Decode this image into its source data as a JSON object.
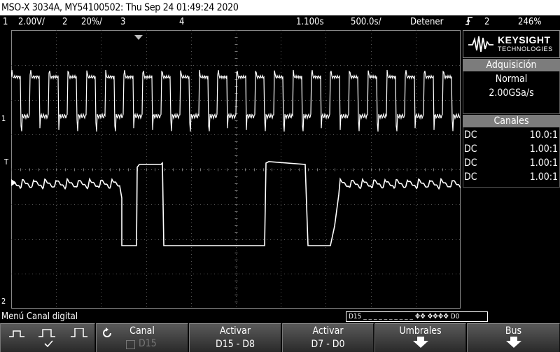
{
  "title": "MSO-X 3034A, MY54100502: Thu Sep 24 01:49:24 2020",
  "status": {
    "ch1_num": "1",
    "ch1_scale": "2.00V/",
    "ch2_num": "2",
    "ch2_scale": "20%/",
    "ch3_num": "3",
    "ch4_num": "4",
    "time_delay": "1.100s",
    "time_scale": "500.0s/",
    "run_state": "Detener",
    "trigger_channel": "2",
    "trigger_level": "246%"
  },
  "brand": {
    "name": "KEYSIGHT",
    "tagline": "TECHNOLOGIES"
  },
  "acquisition": {
    "header": "Adquisición",
    "mode": "Normal",
    "rate": "2.00GSa/s"
  },
  "channels": {
    "header": "Canales",
    "rows": [
      {
        "coupling": "DC",
        "atten": "10.0:1"
      },
      {
        "coupling": "DC",
        "atten": "1.00:1"
      },
      {
        "coupling": "DC",
        "atten": "1.00:1"
      },
      {
        "coupling": "DC",
        "atten": "1.00:1"
      }
    ]
  },
  "markers": {
    "ch1": "1",
    "trigger": "T",
    "ch2": "2"
  },
  "menu_label": "Menú Canal digital",
  "digital_bar": "D15 _ _ _ _  _ _ _ _  _ _ ✥✥  ✥✥✥✥ D0",
  "softkeys": {
    "canal": {
      "title": "Canal",
      "sub": "D15"
    },
    "activar1": {
      "title": "Activar",
      "sub": "D15 - D8"
    },
    "activar2": {
      "title": "Activar",
      "sub": "D7 - D0"
    },
    "umbrales": {
      "title": "Umbrales"
    },
    "bus": {
      "title": "Bus"
    }
  },
  "colors": {
    "trace": "#ffffff",
    "grid": "#5a5a5a",
    "panel_header": "#7c7c7c"
  }
}
